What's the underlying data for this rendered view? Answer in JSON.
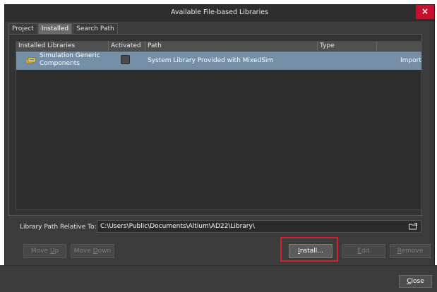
{
  "window": {
    "title": "Available File-based Libraries",
    "close_label": "×"
  },
  "tabs": [
    {
      "label": "Project",
      "active": false
    },
    {
      "label": "Installed",
      "active": true
    },
    {
      "label": "Search Path",
      "active": false
    }
  ],
  "table": {
    "columns": [
      "Installed Libraries",
      "Activated",
      "Path",
      "Type"
    ],
    "rows": [
      {
        "name_line1": "Simulation Generic",
        "name_line2": "Components",
        "activated": false,
        "path": "System Library Provided with MixedSim",
        "type": "Import"
      }
    ]
  },
  "library_path": {
    "label": "Library Path Relative To:",
    "value": "C:\\Users\\Public\\Documents\\Altium\\AD22\\Library\\"
  },
  "buttons": {
    "move_up_pre": "Move ",
    "move_up_key": "U",
    "move_up_post": "p",
    "move_down_pre": "Move ",
    "move_down_key": "D",
    "move_down_post": "own",
    "install_key": "I",
    "install_post": "nstall...",
    "edit_key": "E",
    "edit_post": "dit",
    "remove_key": "R",
    "remove_post": "emove",
    "close_key": "C",
    "close_post": "lose"
  },
  "colors": {
    "selected_row": "#7590a6",
    "highlight_border": "#d4202e",
    "close_button": "#c8102e"
  }
}
